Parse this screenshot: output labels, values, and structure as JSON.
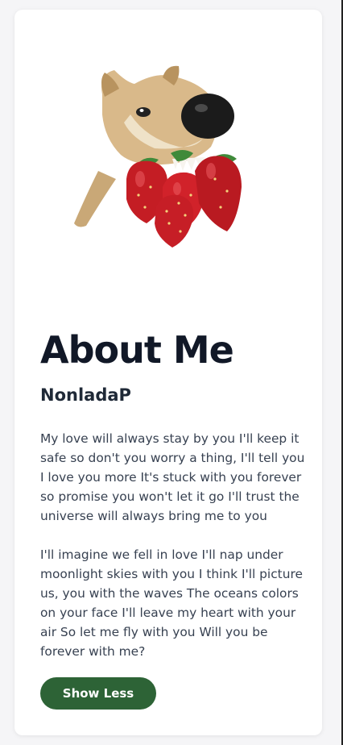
{
  "about": {
    "title": "About Me",
    "name": "NonladaP",
    "paragraphs": [
      "My love will always stay by you I'll keep it safe so don't you worry a thing, I'll tell you I love you more It's stuck with you forever so promise you won't let it go I'll trust the universe will always bring me to you",
      "I'll imagine we fell in love I'll nap under moonlight skies with you I think I'll picture us, you with the waves The oceans colors on your face I'll leave my heart with your air So let me fly with you Will you be forever with me?"
    ],
    "toggle_button": "Show Less",
    "image_icon": "dog-with-strawberries"
  },
  "colors": {
    "button": "#2d6336",
    "title": "#111827",
    "text": "#374151"
  }
}
